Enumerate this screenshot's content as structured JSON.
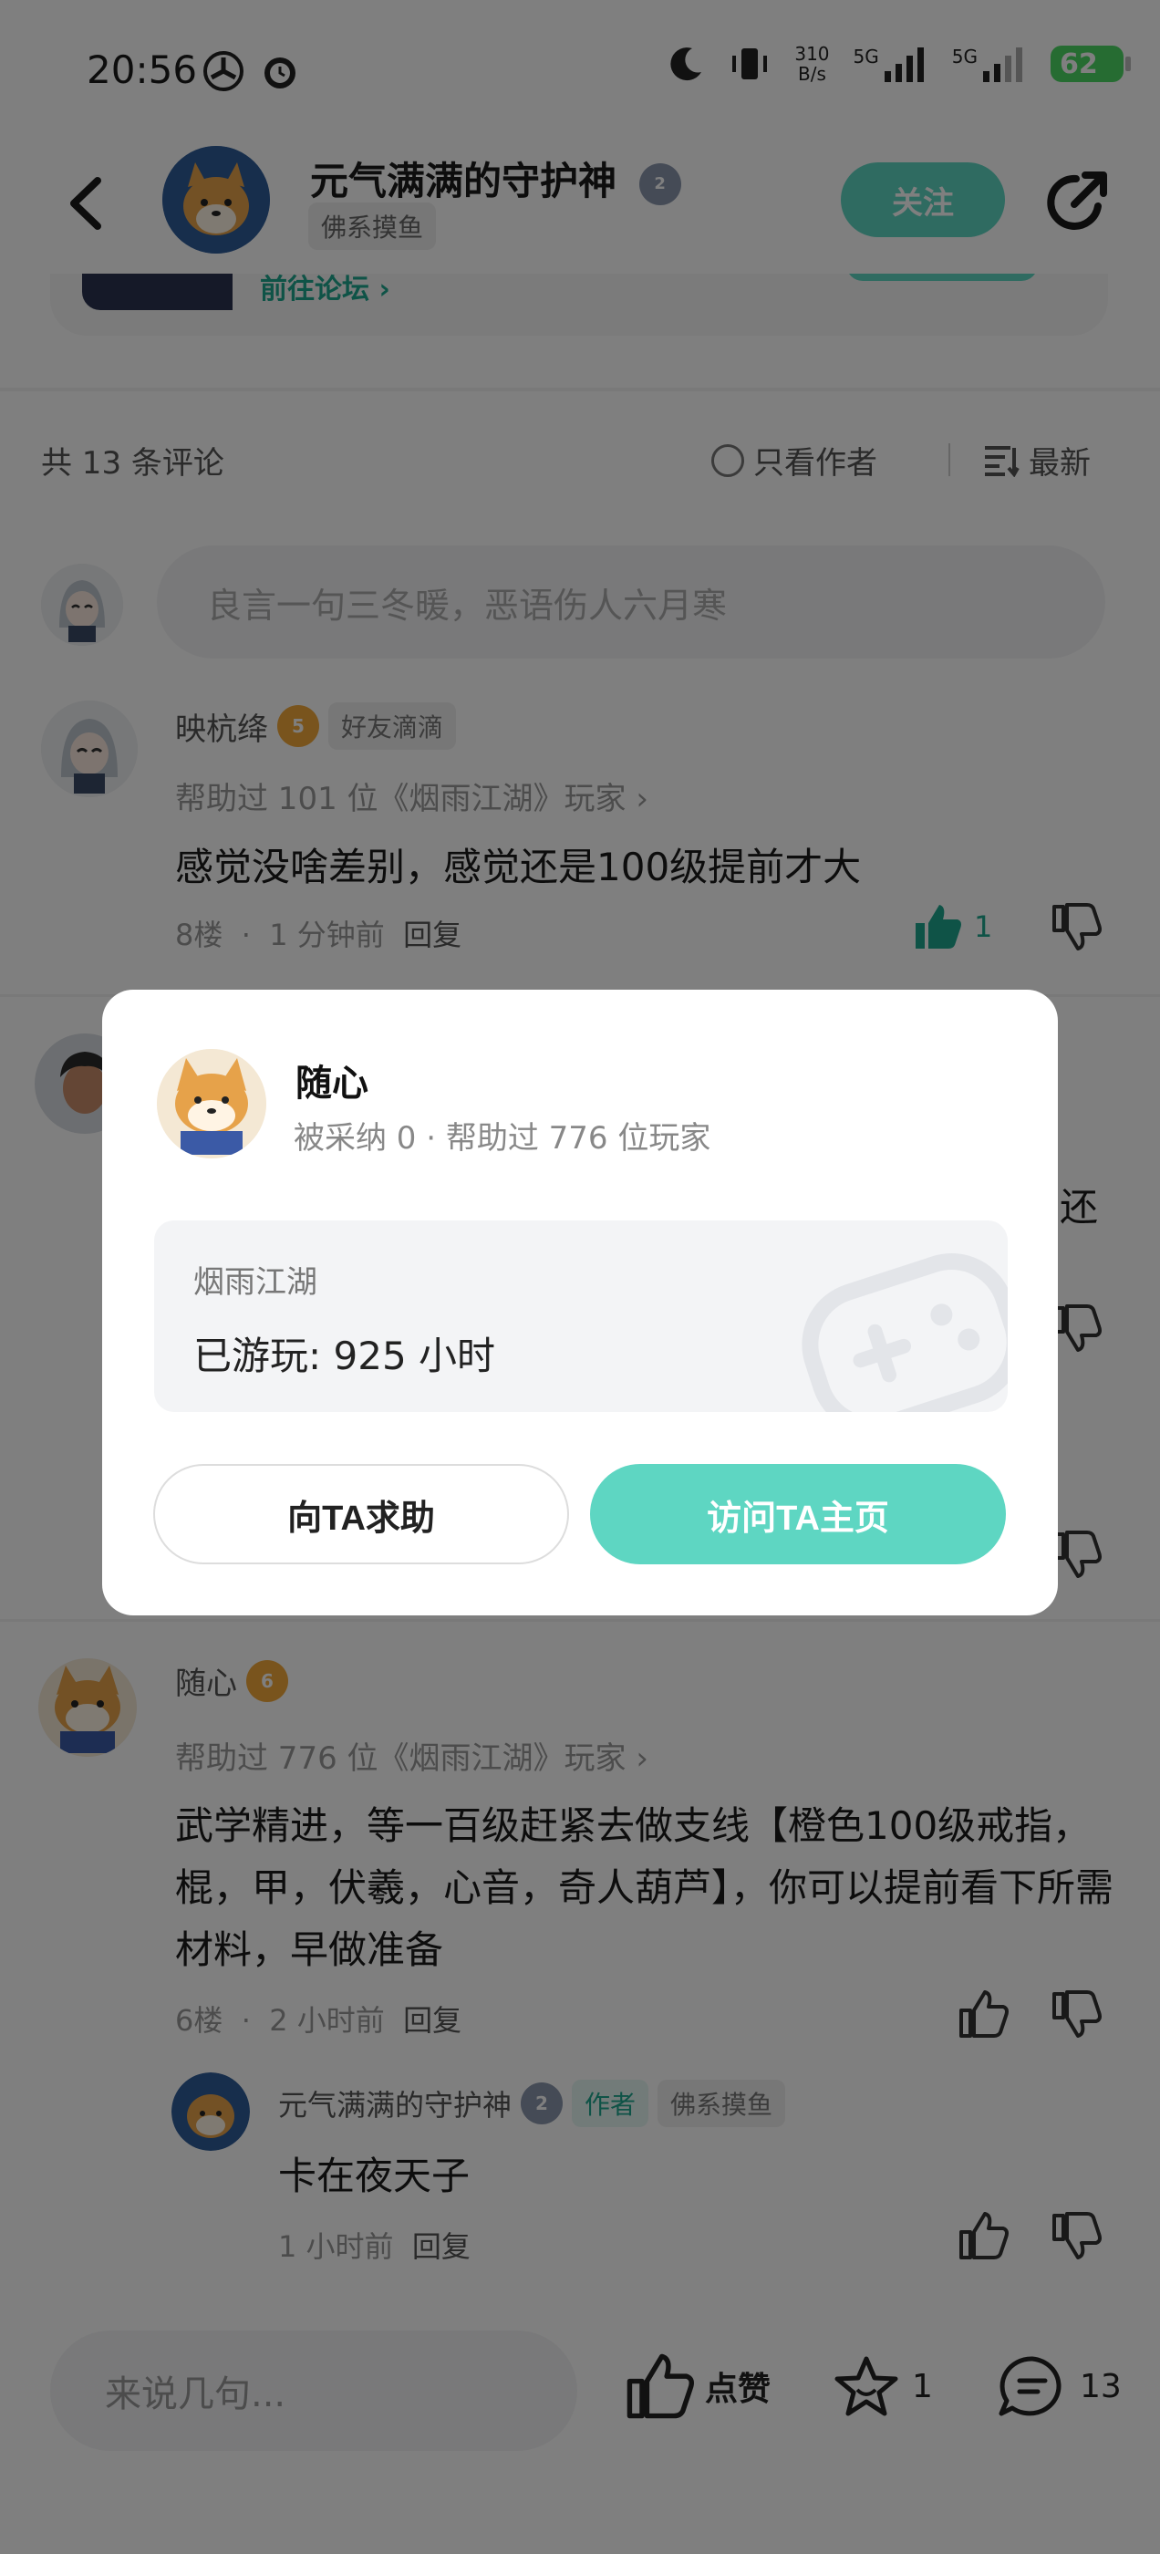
{
  "status": {
    "time": "20:56",
    "speed_top": "310",
    "speed_bottom": "B/s",
    "net1": "5G",
    "net2": "5G",
    "battery": "62"
  },
  "header": {
    "author_name": "元气满满的守护神",
    "author_level": "2",
    "author_tag": "佛系摸鱼",
    "follow_label": "关注",
    "forum_link": "前往论坛"
  },
  "comments_header": {
    "total": "共 13 条评论",
    "only_author": "只看作者",
    "sort": "最新"
  },
  "comment_input": {
    "placeholder": "良言一句三冬暖，恶语伤人六月寒"
  },
  "comments": [
    {
      "name": "映杭绛",
      "level": "5",
      "tag": "好友滴滴",
      "helped": "帮助过 101 位《烟雨江湖》玩家",
      "text": "感觉没啥差别，感觉还是100级提前才大",
      "floor": "8楼",
      "time": "1 分钟前",
      "reply": "回复",
      "likes": "1"
    },
    {
      "partial_text": "还"
    },
    {
      "name": "随心",
      "level": "6",
      "helped": "帮助过 776 位《烟雨江湖》玩家",
      "text": "武学精进，等一百级赶紧去做支线【橙色100级戒指，棍，甲，伏羲，心音，奇人葫芦】，你可以提前看下所需材料，早做准备",
      "floor": "6楼",
      "time": "2 小时前",
      "reply": "回复",
      "sub_reply": {
        "name": "元气满满的守护神",
        "level": "2",
        "author_tag": "作者",
        "tag": "佛系摸鱼",
        "text": "卡在夜天子",
        "time": "1 小时前",
        "reply": "回复"
      }
    }
  ],
  "modal": {
    "name": "随心",
    "stats": "被采纳 0 · 帮助过 776 位玩家",
    "game": "烟雨江湖",
    "playtime": "已游玩: 925 小时",
    "help_button": "向TA求助",
    "visit_button": "访问TA主页"
  },
  "bottom_bar": {
    "placeholder": "来说几句...",
    "like_label": "点赞",
    "fav_count": "1",
    "comment_count": "13"
  },
  "colors": {
    "accent": "#5ed6c2",
    "link": "#1fa78e",
    "badge_gold": "#f2a93b",
    "badge_grey": "#8a96ad"
  }
}
